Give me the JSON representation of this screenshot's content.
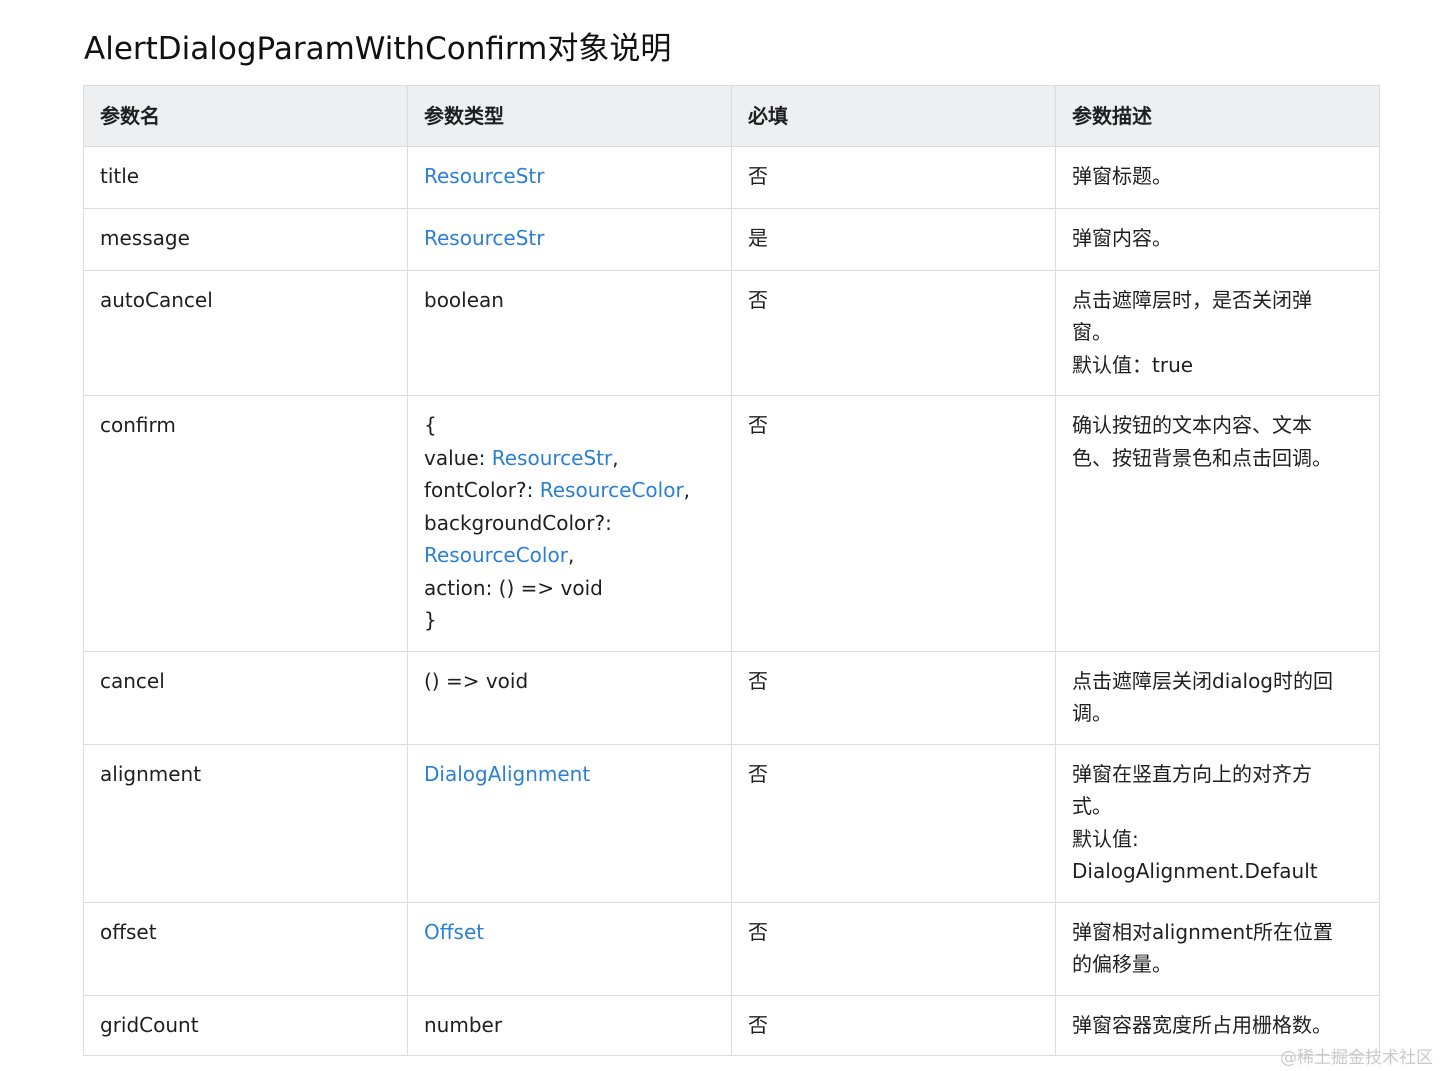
{
  "page_title": "AlertDialogParamWithConfirm对象说明",
  "headers": [
    "参数名",
    "参数类型",
    "必填",
    "参数描述"
  ],
  "rows": {
    "title": {
      "name": "title",
      "type": "ResourceStr",
      "required": "否",
      "desc": [
        "弹窗标题。"
      ]
    },
    "message": {
      "name": "message",
      "type": "ResourceStr",
      "required": "是",
      "desc": [
        "弹窗内容。"
      ]
    },
    "autoCancel": {
      "name": "autoCancel",
      "type": "boolean",
      "required": "否",
      "desc": [
        "点击遮障层时，是否关闭弹",
        "窗。",
        "默认值：true"
      ]
    },
    "confirm": {
      "name": "confirm",
      "type_lines": [
        "{",
        "value: ",
        "ResourceStr",
        ",",
        "fontColor?: ",
        "ResourceColor",
        ",",
        "backgroundColor?:",
        "ResourceColor",
        ",",
        "action: () => void",
        "}"
      ],
      "required": "否",
      "desc": [
        "确认按钮的文本内容、文本",
        "色、按钮背景色和点击回调。"
      ]
    },
    "cancel": {
      "name": "cancel",
      "type": "() => void",
      "required": "否",
      "desc": [
        "点击遮障层关闭dialog时的回",
        "调。"
      ]
    },
    "alignment": {
      "name": "alignment",
      "type": "DialogAlignment",
      "required": "否",
      "desc": [
        "弹窗在竖直方向上的对齐方",
        "式。",
        "默认值:",
        "DialogAlignment.Default"
      ]
    },
    "offset": {
      "name": "offset",
      "type": "Offset",
      "required": "否",
      "desc": [
        "弹窗相对alignment所在位置",
        "的偏移量。"
      ]
    },
    "gridCount": {
      "name": "gridCount",
      "type": "number",
      "required": "否",
      "desc": [
        "弹窗容器宽度所占用栅格数。"
      ]
    }
  },
  "watermark": "@稀土掘金技术社区",
  "colors": {
    "link": "#2b7fd4",
    "header_bg": "#eeeff1",
    "border": "#dcdcdc"
  }
}
